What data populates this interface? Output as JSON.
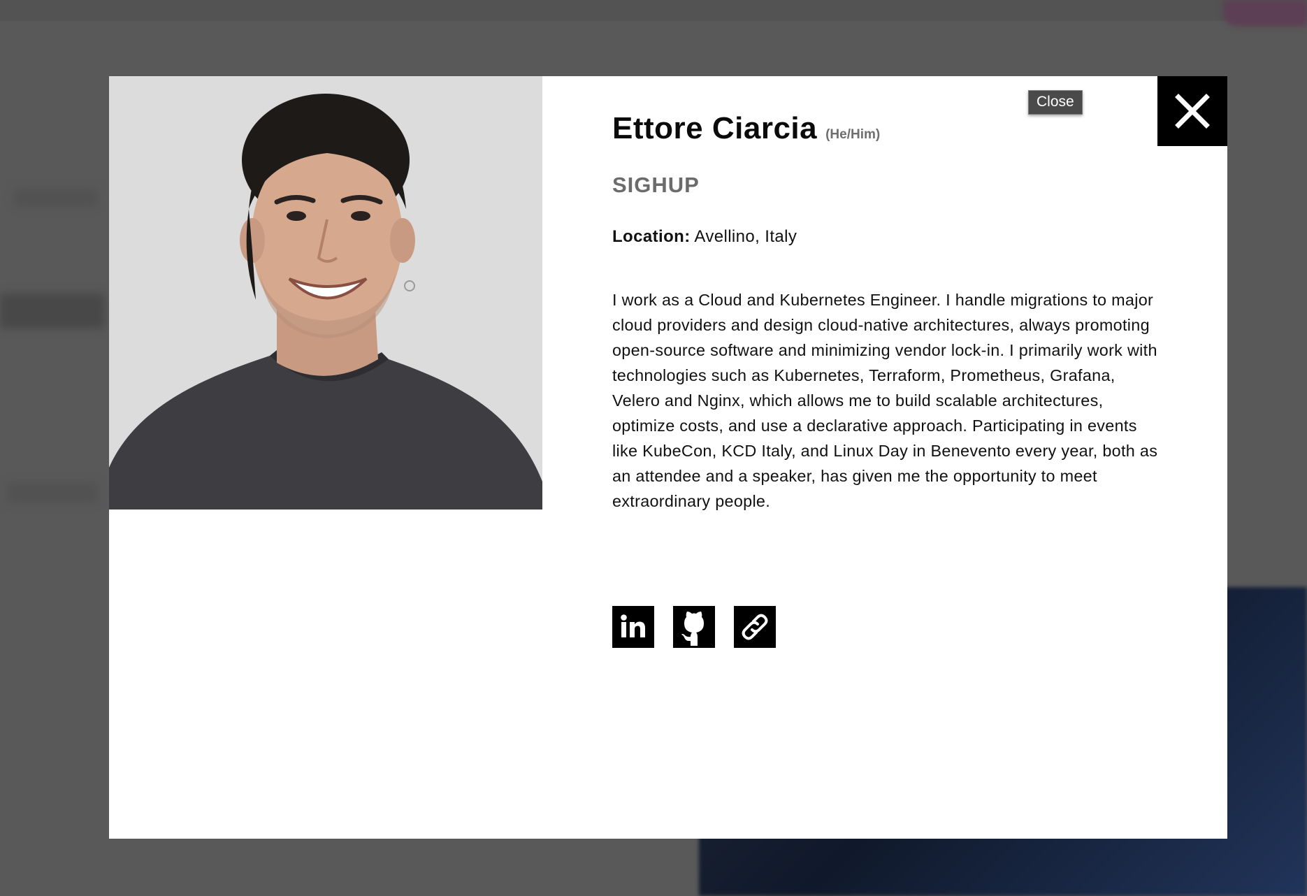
{
  "speaker": {
    "name": "Ettore Ciarcia",
    "pronouns": "(He/Him)",
    "company": "SIGHUP",
    "location_label": "Location:",
    "location_value": "Avellino, Italy",
    "bio": "I work as a Cloud and Kubernetes Engineer. I handle migrations to major cloud providers and design cloud-native architectures, always promoting open-source software and minimizing vendor lock-in. I primarily work with technologies such as Kubernetes, Terraform, Prometheus, Grafana, Velero and Nginx, which allows me to build scalable architectures, optimize costs, and use a declarative approach. Participating in events like KubeCon, KCD Italy, and Linux Day in Benevento every year, both as an attendee and a speaker, has given me the opportunity to meet extraordinary people."
  },
  "close": {
    "icon": "close-x-icon",
    "tooltip": "Close"
  },
  "socials": [
    {
      "icon": "linkedin-icon"
    },
    {
      "icon": "github-icon"
    },
    {
      "icon": "link-icon"
    }
  ],
  "colors": {
    "overlay": "#595959",
    "modal_bg": "#ffffff",
    "text": "#111111",
    "muted": "#6b6b6b",
    "button_bg": "#000000"
  }
}
